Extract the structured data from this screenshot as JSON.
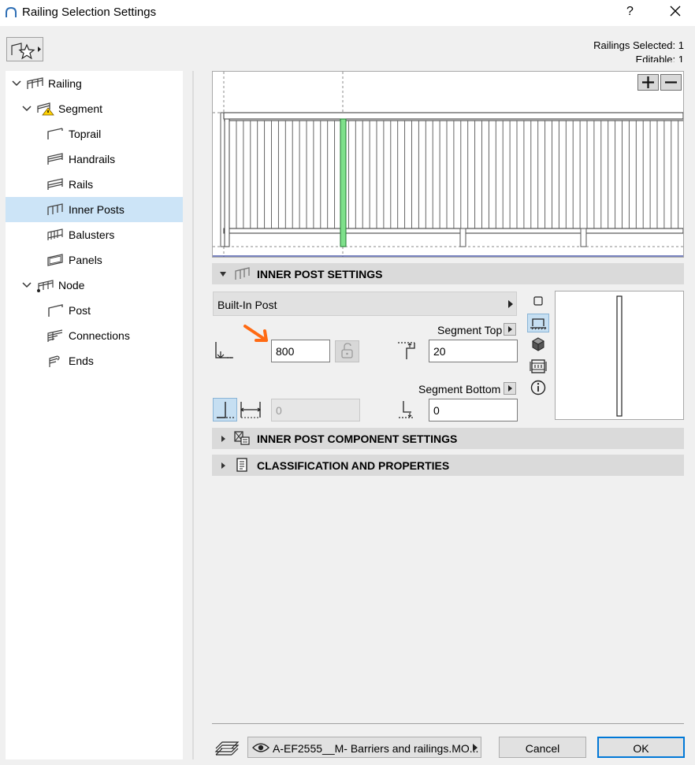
{
  "window": {
    "title": "Railing Selection Settings",
    "help_label": "?",
    "selection_info": [
      "Railings Selected: 1",
      "Editable: 1"
    ]
  },
  "tree": {
    "items": [
      {
        "label": "Railing",
        "icon": "railing-icon"
      },
      {
        "label": "Segment",
        "icon": "segment-warning-icon"
      },
      {
        "label": "Toprail",
        "icon": "toprail-icon"
      },
      {
        "label": "Handrails",
        "icon": "handrails-icon"
      },
      {
        "label": "Rails",
        "icon": "rails-icon"
      },
      {
        "label": "Inner Posts",
        "icon": "inner-posts-icon",
        "selected": true
      },
      {
        "label": "Balusters",
        "icon": "balusters-icon"
      },
      {
        "label": "Panels",
        "icon": "panels-icon"
      },
      {
        "label": "Node",
        "icon": "node-icon"
      },
      {
        "label": "Post",
        "icon": "post-icon"
      },
      {
        "label": "Connections",
        "icon": "connections-icon"
      },
      {
        "label": "Ends",
        "icon": "ends-icon"
      }
    ]
  },
  "preview": {
    "zoom_in": "+",
    "zoom_out": "−",
    "highlight_color": "#7ee08a"
  },
  "inner_post_settings": {
    "header": "INNER POST SETTINGS",
    "post_type": "Built-In Post",
    "spacing_value": "800",
    "segment_top_label": "Segment Top",
    "segment_top_value": "20",
    "segment_bottom_label": "Segment Bottom",
    "segment_bottom_value": "0",
    "offset_value": "0"
  },
  "sections": {
    "component_settings": "INNER POST COMPONENT SETTINGS",
    "classification": "CLASSIFICATION AND PROPERTIES"
  },
  "footer": {
    "layer": "A-EF2555__M- Barriers and railings.MO...",
    "cancel": "Cancel",
    "ok": "OK"
  },
  "colors": {
    "accent": "#0078d7",
    "annotation_arrow": "#ff6a13",
    "selected_bg": "#cce4f7"
  }
}
